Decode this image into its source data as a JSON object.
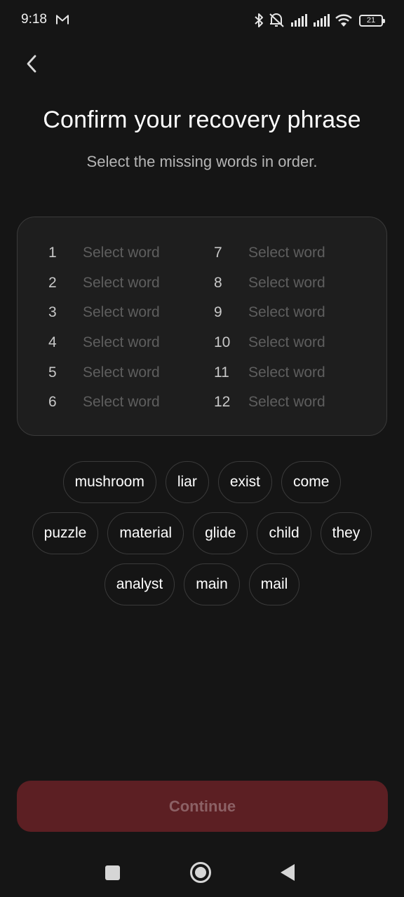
{
  "status_bar": {
    "time": "9:18",
    "battery": "21",
    "icons": [
      "gmail-icon",
      "bluetooth-icon",
      "mute-icon",
      "signal-icon",
      "signal-icon",
      "wifi-icon",
      "battery-icon"
    ]
  },
  "header": {
    "back_icon": "chevron-left-icon",
    "title": "Confirm your recovery phrase",
    "subtitle": "Select the missing words in order."
  },
  "slots": {
    "left": [
      {
        "num": "1",
        "text": "Select word"
      },
      {
        "num": "2",
        "text": "Select word"
      },
      {
        "num": "3",
        "text": "Select word"
      },
      {
        "num": "4",
        "text": "Select word"
      },
      {
        "num": "5",
        "text": "Select word"
      },
      {
        "num": "6",
        "text": "Select word"
      }
    ],
    "right": [
      {
        "num": "7",
        "text": "Select word"
      },
      {
        "num": "8",
        "text": "Select word"
      },
      {
        "num": "9",
        "text": "Select word"
      },
      {
        "num": "10",
        "text": "Select word"
      },
      {
        "num": "11",
        "text": "Select word"
      },
      {
        "num": "12",
        "text": "Select word"
      }
    ]
  },
  "chips": {
    "row1": [
      "mushroom",
      "liar",
      "exist",
      "come"
    ],
    "row2": [
      "puzzle",
      "material",
      "glide",
      "child",
      "they"
    ],
    "row3": [
      "analyst",
      "main",
      "mail"
    ]
  },
  "continue_label": "Continue",
  "colors": {
    "background": "#151515",
    "panel": "#1e1e1e",
    "border": "#3a3a3a",
    "button_disabled": "#5c1f23",
    "button_text_disabled": "#8c6165"
  }
}
